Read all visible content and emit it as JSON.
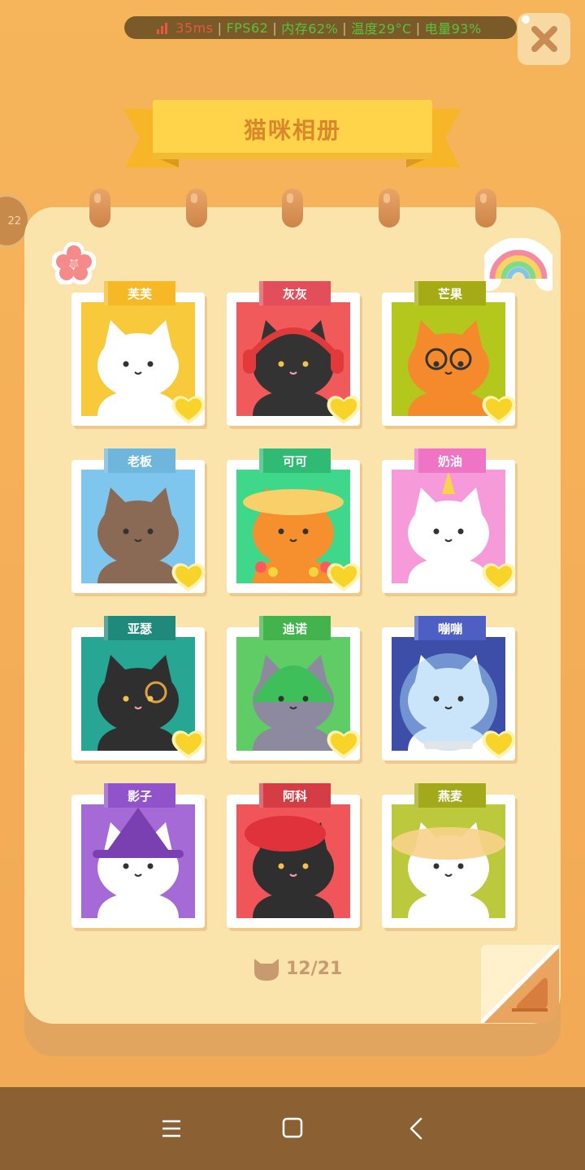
{
  "status_bar": {
    "ping": "35ms",
    "fps": "FPS62",
    "memory": "内存62%",
    "temperature": "温度29°C",
    "battery": "电量93%"
  },
  "title": "猫咪相册",
  "level_badge": "22",
  "cats": [
    {
      "name": "芙芙",
      "tag_color": "#f6b824",
      "bg": "#f9c93c",
      "liked": true
    },
    {
      "name": "灰灰",
      "tag_color": "#e24f5b",
      "bg": "#f05a5a",
      "liked": true
    },
    {
      "name": "芒果",
      "tag_color": "#a5ab14",
      "bg": "#b3c71c",
      "liked": true
    },
    {
      "name": "老板",
      "tag_color": "#6fb6dc",
      "bg": "#7fc6ee",
      "liked": true
    },
    {
      "name": "可可",
      "tag_color": "#2fbb74",
      "bg": "#3fd88a",
      "liked": true
    },
    {
      "name": "奶油",
      "tag_color": "#ef74c6",
      "bg": "#f79ad9",
      "liked": true
    },
    {
      "name": "亚瑟",
      "tag_color": "#1f8a7c",
      "bg": "#27a694",
      "liked": true
    },
    {
      "name": "迪诺",
      "tag_color": "#43b34d",
      "bg": "#5fcc65",
      "liked": true
    },
    {
      "name": "嘣嘣",
      "tag_color": "#4e5fc4",
      "bg": "#3c4ea8",
      "liked": true
    },
    {
      "name": "影子",
      "tag_color": "#9153c9",
      "bg": "#a56ad6",
      "liked": false
    },
    {
      "name": "阿科",
      "tag_color": "#d43c46",
      "bg": "#f0555a",
      "liked": false
    },
    {
      "name": "燕麦",
      "tag_color": "#a2a91a",
      "bg": "#bcc93c",
      "liked": false
    }
  ],
  "progress": {
    "text": "12/21",
    "collected": 12,
    "total": 21
  },
  "icons": {
    "close": "close-x-icon",
    "flower": "flower-sticker-icon",
    "rainbow": "rainbow-sticker-icon",
    "heart": "heart-icon",
    "cat_head": "cat-head-icon",
    "menu": "menu-icon",
    "home": "home-icon",
    "back": "back-icon"
  }
}
